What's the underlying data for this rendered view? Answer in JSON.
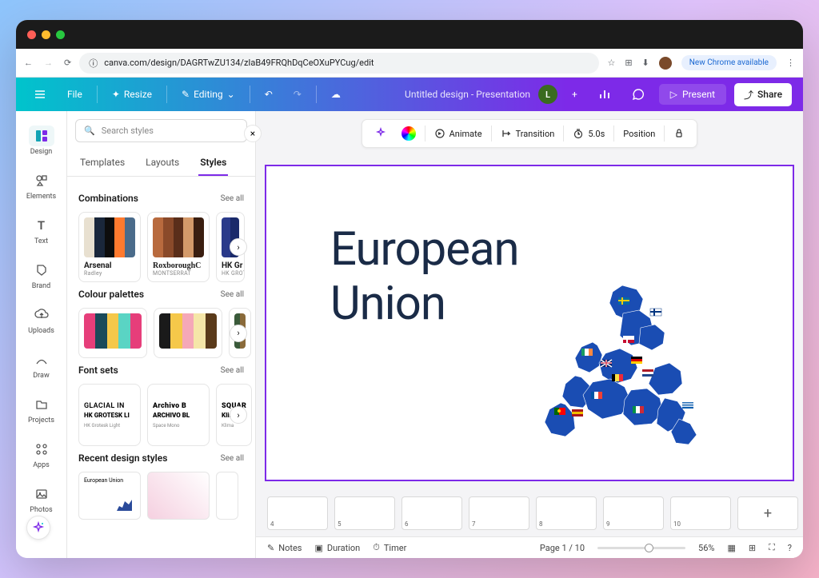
{
  "browser": {
    "url": "canva.com/design/DAGRTwZU134/zIaB49FRQhDqCeOXuPYCug/edit",
    "chrome_badge": "New Chrome available"
  },
  "header": {
    "file": "File",
    "resize": "Resize",
    "editing": "Editing",
    "doc_title": "Untitled design - Presentation",
    "avatar_letter": "L",
    "present": "Present",
    "share": "Share"
  },
  "rail": {
    "design": "Design",
    "elements": "Elements",
    "text": "Text",
    "brand": "Brand",
    "uploads": "Uploads",
    "draw": "Draw",
    "projects": "Projects",
    "apps": "Apps",
    "photos": "Photos"
  },
  "side": {
    "search_placeholder": "Search styles",
    "tab_templates": "Templates",
    "tab_layouts": "Layouts",
    "tab_styles": "Styles",
    "see_all": "See all",
    "combinations": {
      "title": "Combinations",
      "cards": [
        {
          "t1": "Arsenal",
          "t2": "Radley",
          "colors": [
            "#e8e0d0",
            "#1a273b",
            "#0d0d0d",
            "#ff7a2e",
            "#4a6b8a"
          ]
        },
        {
          "t1": "RoxboroughC",
          "t2": "MONTSERRAT",
          "colors": [
            "#b86a3e",
            "#8a4a2a",
            "#5a2e1a",
            "#d49a6a",
            "#3a1e10"
          ]
        },
        {
          "t1": "HK Gr",
          "t2": "HK GROT",
          "colors": [
            "#2a3a8a",
            "#1a2a6a",
            "#3a4aaa"
          ]
        }
      ]
    },
    "palettes": {
      "title": "Colour palettes",
      "cards": [
        {
          "colors": [
            "#e63e7a",
            "#1a4a5a",
            "#f5c84a",
            "#5ad4c4",
            "#e63e7a"
          ]
        },
        {
          "colors": [
            "#1a1a1a",
            "#f5c84a",
            "#f5a8b8",
            "#f5e6a8",
            "#5a3a1a"
          ]
        },
        {
          "colors": [
            "#3a5a3a",
            "#8a6a3a",
            "#5a3a1a"
          ]
        }
      ]
    },
    "fonts": {
      "title": "Font sets",
      "cards": [
        {
          "l1": "GLACIAL IN",
          "l2": "HK GROTESK LI",
          "l3": "HK Grotesk Light"
        },
        {
          "l1": "Archivo B",
          "l2": "ARCHIVO BL",
          "l3": "Space Mono"
        },
        {
          "l1": "SQUAR",
          "l2": "Klima",
          "l3": "Klima"
        }
      ]
    },
    "recent": {
      "title": "Recent design styles",
      "cards": [
        "European Union",
        "",
        ""
      ]
    }
  },
  "context_toolbar": {
    "animate": "Animate",
    "transition": "Transition",
    "timing": "5.0s",
    "position": "Position"
  },
  "slide": {
    "title_line1": "European",
    "title_line2": "Union"
  },
  "thumbs": {
    "pages": [
      4,
      5,
      6,
      7,
      8,
      9,
      10
    ]
  },
  "bottom": {
    "notes": "Notes",
    "duration": "Duration",
    "timer": "Timer",
    "page_indicator": "Page 1 / 10",
    "zoom": "56%"
  }
}
